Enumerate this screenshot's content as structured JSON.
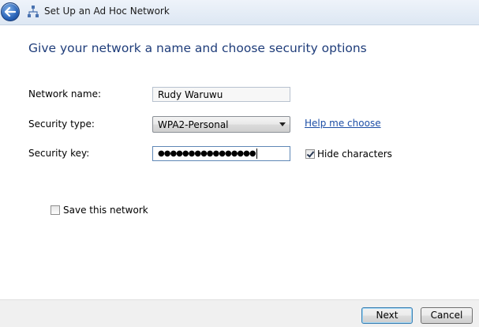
{
  "window": {
    "title": "Set Up an Ad Hoc Network"
  },
  "page": {
    "heading": "Give your network a name and choose security options"
  },
  "form": {
    "network_name_label": "Network name:",
    "network_name_value": "Rudy Waruwu",
    "security_type_label": "Security type:",
    "security_type_value": "WPA2-Personal",
    "help_link": "Help me choose",
    "security_key_label": "Security key:",
    "security_key_masked": "●●●●●●●●●●●●●●●●",
    "hide_characters_label": "Hide characters",
    "hide_characters_checked": true,
    "save_network_label": "Save this network",
    "save_network_checked": false
  },
  "footer": {
    "next_label": "Next",
    "cancel_label": "Cancel"
  },
  "icons": {
    "back": "back-arrow-icon",
    "network": "network-icon"
  },
  "colors": {
    "heading": "#1f3d7a",
    "link": "#1c4ea6"
  }
}
